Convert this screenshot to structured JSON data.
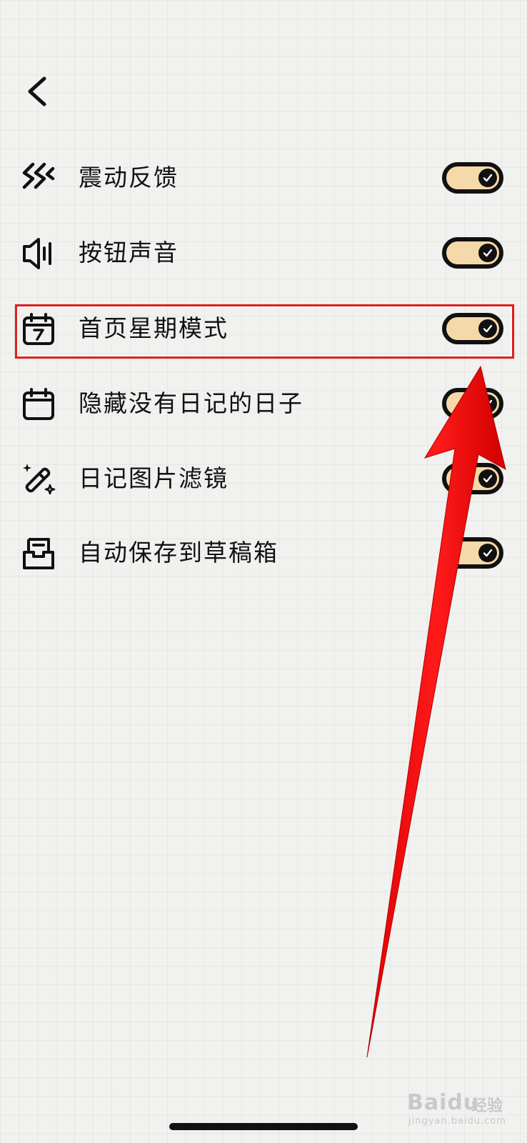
{
  "settings": {
    "items": [
      {
        "id": "vibration",
        "label": "震动反馈",
        "icon": "vibration-icon",
        "enabled": true
      },
      {
        "id": "button-sound",
        "label": "按钮声音",
        "icon": "speaker-icon",
        "enabled": true
      },
      {
        "id": "weekday-mode",
        "label": "首页星期模式",
        "icon": "calendar-week-icon",
        "enabled": true
      },
      {
        "id": "hide-empty-days",
        "label": "隐藏没有日记的日子",
        "icon": "calendar-icon",
        "enabled": true
      },
      {
        "id": "image-filter",
        "label": "日记图片滤镜",
        "icon": "magic-wand-icon",
        "enabled": true
      },
      {
        "id": "auto-save-draft",
        "label": "自动保存到草稿箱",
        "icon": "inbox-tray-icon",
        "enabled": true
      }
    ]
  },
  "colors": {
    "toggle_track": "#f6d9a8",
    "toggle_border": "#111111",
    "highlight": "#e02020",
    "arrow": "#ff0000"
  },
  "watermark": {
    "brand": "Baidu",
    "brand_cn": "经验",
    "sub": "jingyan.baidu.com"
  }
}
